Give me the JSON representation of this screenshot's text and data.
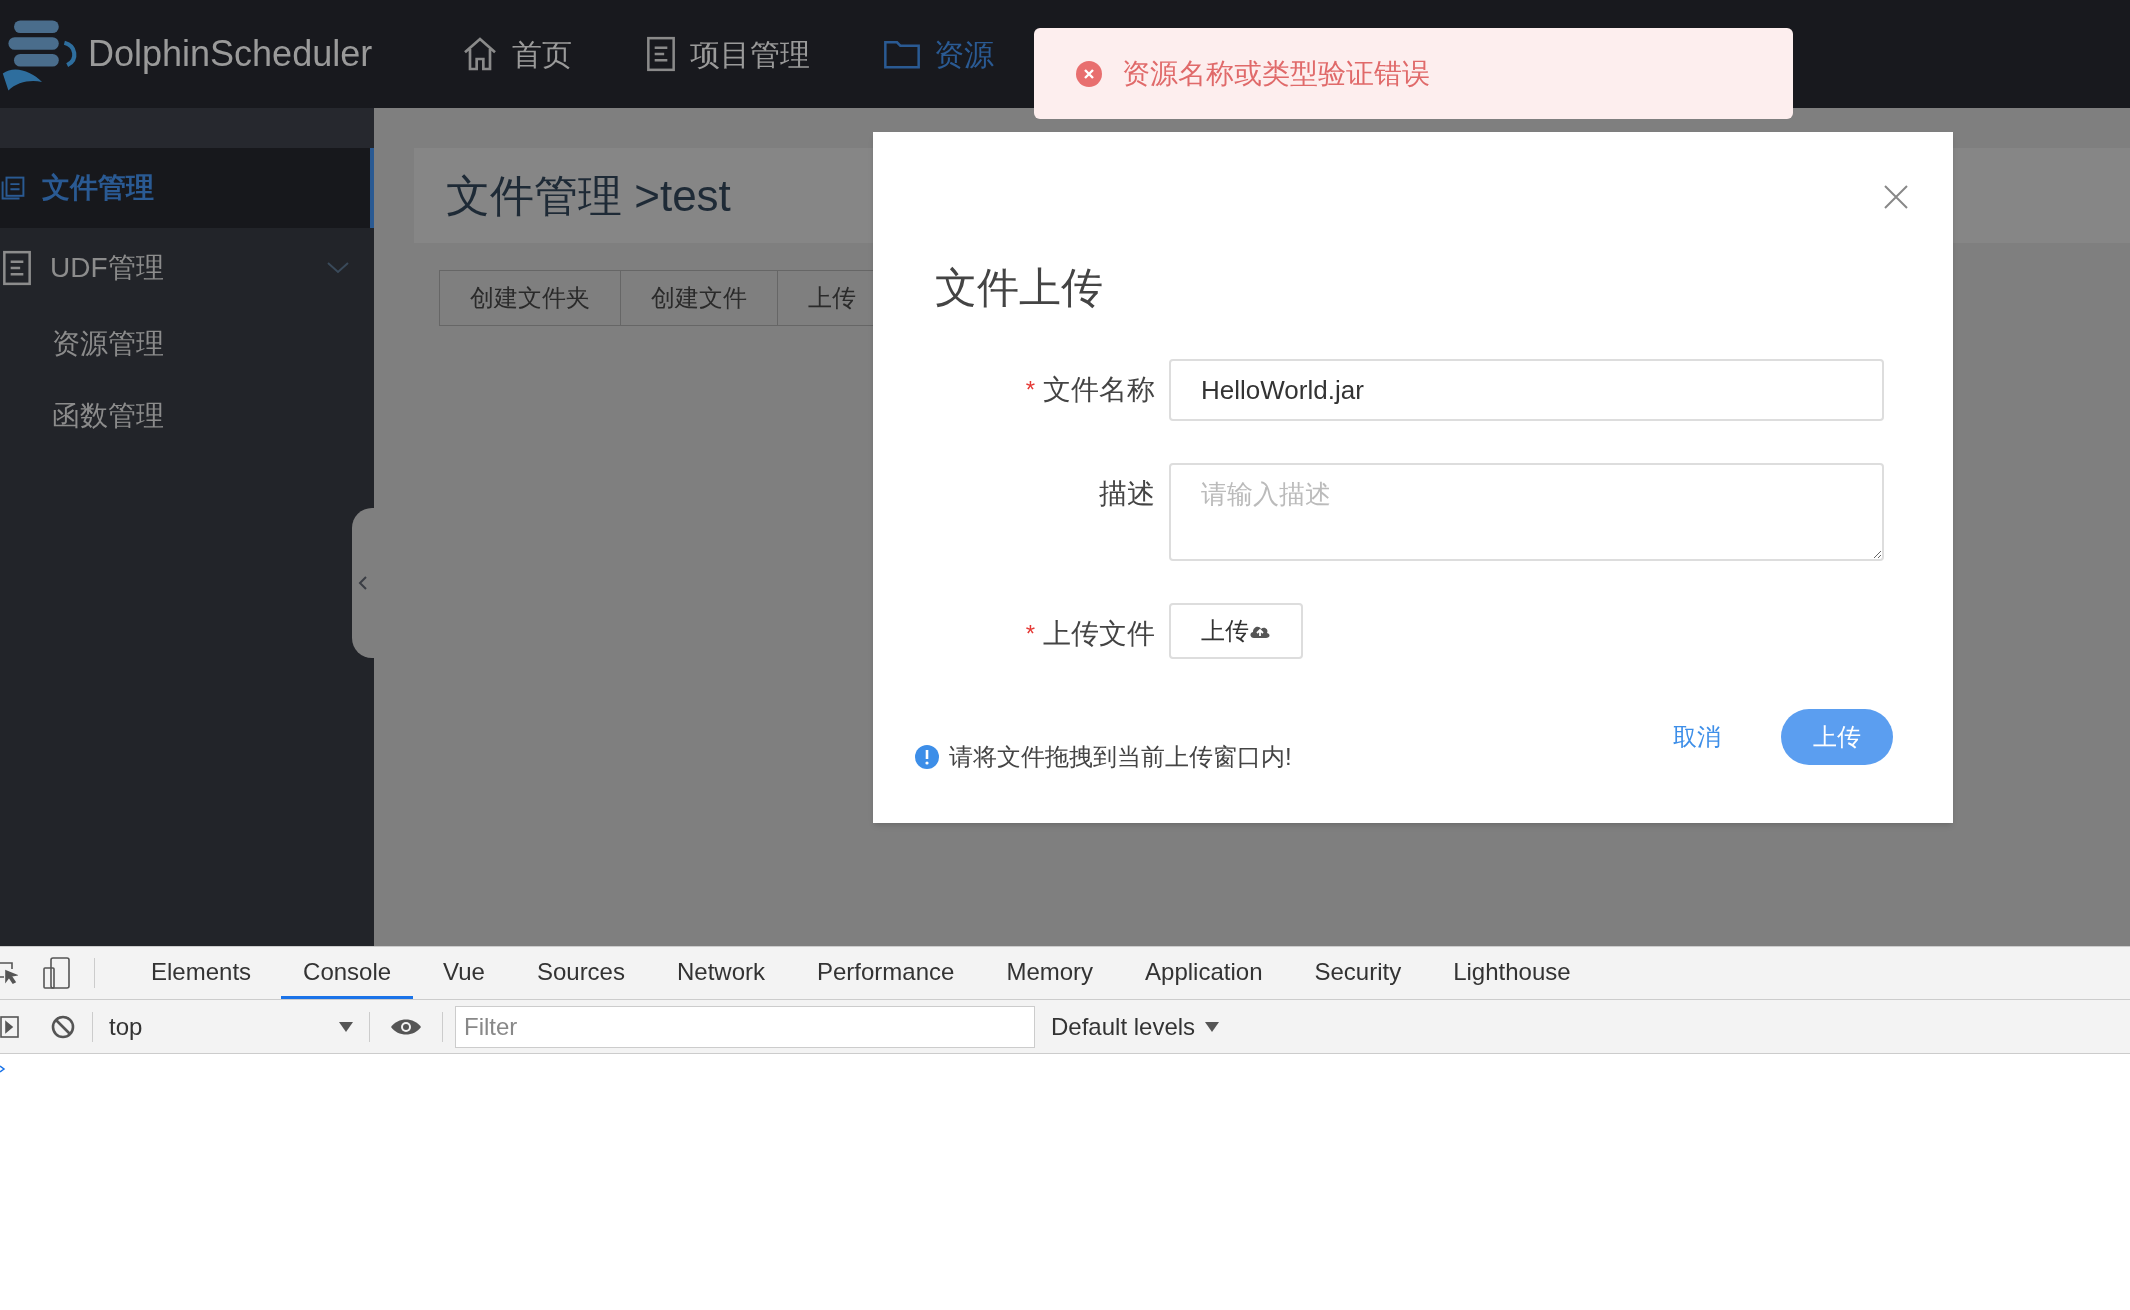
{
  "header": {
    "logo_text": "DolphinScheduler",
    "nav": [
      {
        "label": "首页",
        "selected": false
      },
      {
        "label": "项目管理",
        "selected": false
      },
      {
        "label": "资源",
        "selected": true
      }
    ]
  },
  "sidebar": {
    "items": [
      {
        "label": "文件管理",
        "selected": true
      },
      {
        "label": "UDF管理",
        "selected": false,
        "expanded": true,
        "children": [
          {
            "label": "资源管理",
            "selected": false
          },
          {
            "label": "函数管理",
            "selected": false
          }
        ]
      }
    ]
  },
  "page": {
    "title": "文件管理 >test",
    "buttons": [
      "创建文件夹",
      "创建文件",
      "上传"
    ]
  },
  "toast": {
    "message": "资源名称或类型验证错误"
  },
  "dialog": {
    "title": "文件上传",
    "fields": [
      {
        "kind": "input",
        "label": "文件名称",
        "required_mark": "*",
        "value": "HelloWorld.jar"
      },
      {
        "kind": "textarea",
        "label": "描述",
        "placeholder": "请输入描述"
      },
      {
        "kind": "upload",
        "label": "上传文件",
        "required_mark": "*",
        "button": "上传"
      }
    ],
    "hint": "请将文件拖拽到当前上传窗口内!",
    "cancel": "取消",
    "submit": "上传"
  },
  "devtools": {
    "tabs": [
      {
        "label": "Elements",
        "selected": false
      },
      {
        "label": "Console",
        "selected": true
      },
      {
        "label": "Vue",
        "selected": false
      },
      {
        "label": "Sources",
        "selected": false
      },
      {
        "label": "Network",
        "selected": false
      },
      {
        "label": "Performance",
        "selected": false
      },
      {
        "label": "Memory",
        "selected": false
      },
      {
        "label": "Application",
        "selected": false
      },
      {
        "label": "Security",
        "selected": false
      },
      {
        "label": "Lighthouse",
        "selected": false
      }
    ],
    "context": "top",
    "filter_placeholder": "Filter",
    "levels": "Default levels"
  }
}
